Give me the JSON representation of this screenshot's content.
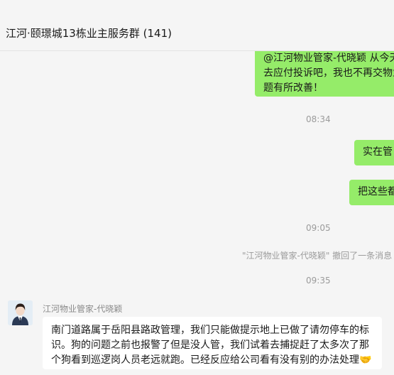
{
  "header": {
    "title": "江河·颐璟城13栋业主服务群 (141)"
  },
  "messages": {
    "m1_lines": [
      "@江河物业管家-代晓颖 从今天",
      "去应付投诉吧，我也不再交物业",
      "题有所改善！"
    ],
    "time1": "08:34",
    "m2": "实在管",
    "m3": "把这些都",
    "time2": "09:05",
    "recall": "\"江河物业管家-代晓颖\" 撤回了一条消息",
    "time3": "09:35",
    "sender": "江河物业管家-代晓颖",
    "incoming_lines": [
      "南门道路属于岳阳县路政管理，我们只能做提示地上已做了请勿停车的标",
      "识。狗的问题之前也报警了但是没人管，我们试着去捕捉赶了太多次了那",
      "个狗看到巡逻岗人员老远就跑。已经反应给公司看有没有别的办法处理"
    ],
    "incoming_emoji": "handshake-emoji"
  },
  "colors": {
    "outgoing": "#95ec69",
    "incoming": "#ffffff",
    "background": "#f5f5f5"
  }
}
